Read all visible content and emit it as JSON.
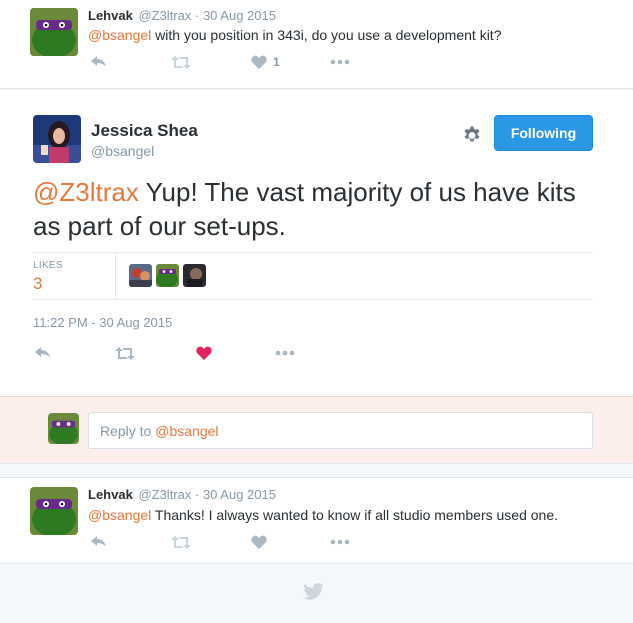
{
  "tweet1": {
    "name": "Lehvak",
    "handle": "@Z3ltrax",
    "date": "30 Aug 2015",
    "mention": "@bsangel",
    "text": " with you position in 343i, do you use a development kit?",
    "like_count": "1"
  },
  "main": {
    "name": "Jessica Shea",
    "handle": "@bsangel",
    "follow_label": "Following",
    "mention": "@Z3ltrax",
    "text_line1": " Yup! The vast majority of us have kits",
    "text_line2": "as part of our set-ups.",
    "likes_label": "LIKES",
    "likes_count": "3",
    "timestamp": "11:22 PM - 30 Aug 2015"
  },
  "reply": {
    "prefix": "Reply to ",
    "mention": "@bsangel"
  },
  "tweet2": {
    "name": "Lehvak",
    "handle": "@Z3ltrax",
    "date": "30 Aug 2015",
    "mention": "@bsangel",
    "text": " Thanks! I always wanted to know if all studio members used one."
  },
  "colors": {
    "accent": "#2b98e6",
    "mention": "#e8773a",
    "heart": "#e0245e",
    "icon_gray": "#aab8c2",
    "reply_bg": "#fcefeb"
  },
  "icons": [
    "reply-icon",
    "retweet-icon",
    "heart-icon",
    "more-icon",
    "gear-icon",
    "twitter-bird-icon"
  ]
}
